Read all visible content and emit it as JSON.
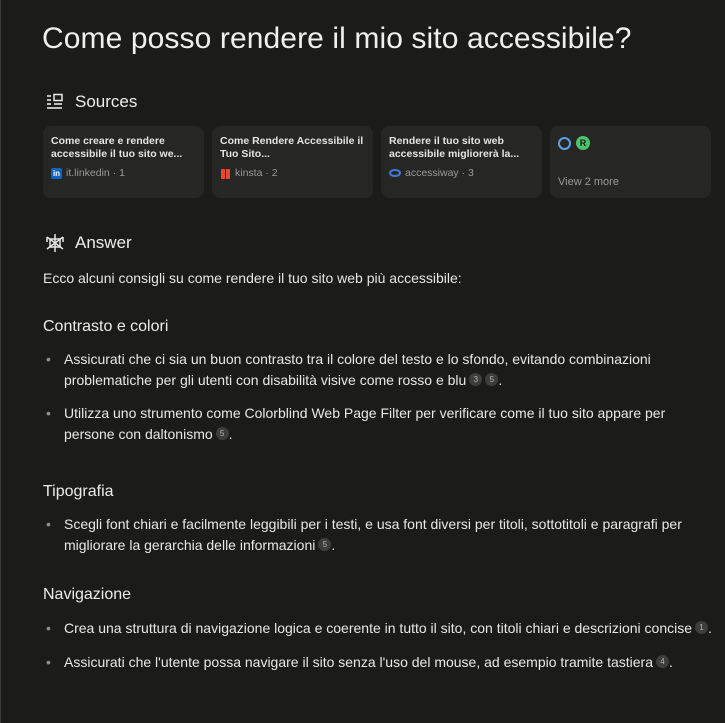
{
  "query": "Come posso rendere il mio sito accessibile?",
  "sources": {
    "heading": "Sources",
    "cards": [
      {
        "title": "Come creare e rendere accessibile il tuo sito we...",
        "site": "it.linkedin",
        "num": "1",
        "favicon": "linkedin-favicon"
      },
      {
        "title": "Come Rendere Accessibile il Tuo Sito...",
        "site": "kinsta",
        "num": "2",
        "favicon": "kinsta-favicon"
      },
      {
        "title": "Rendere il tuo sito web accessibile migliorerà la...",
        "site": "accessiway",
        "num": "3",
        "favicon": "accessiway-favicon"
      }
    ],
    "more_label": "View 2 more"
  },
  "answer": {
    "heading": "Answer",
    "intro": "Ecco alcuni consigli su come rendere il tuo sito web più accessibile:",
    "sections": [
      {
        "title": "Contrasto e colori",
        "items": [
          {
            "text": "Assicurati che ci sia un buon contrasto tra il colore del testo e lo sfondo, evitando combinazioni problematiche per gli utenti con disabilità visive come rosso e blu",
            "cites": [
              "3",
              "5"
            ]
          },
          {
            "text": "Utilizza uno strumento come Colorblind Web Page Filter per verificare come il tuo sito appare per persone con daltonismo",
            "cites": [
              "5"
            ]
          }
        ]
      },
      {
        "title": "Tipografia",
        "items": [
          {
            "text": "Scegli font chiari e facilmente leggibili per i testi, e usa font diversi per titoli, sottotitoli e paragrafi per migliorare la gerarchia delle informazioni",
            "cites": [
              "5"
            ]
          }
        ]
      },
      {
        "title": "Navigazione",
        "items": [
          {
            "text": "Crea una struttura di navigazione logica e coerente in tutto il sito, con titoli chiari e descrizioni concise",
            "cites": [
              "1"
            ]
          },
          {
            "text": "Assicurati che l'utente possa navigare il sito senza l'uso del mouse, ad esempio tramite tastiera",
            "cites": [
              "4"
            ]
          }
        ]
      }
    ]
  },
  "colors": {
    "background": "#1b1b1a",
    "card": "#262624",
    "text": "#e8e8e6",
    "muted": "#9a9a97"
  }
}
